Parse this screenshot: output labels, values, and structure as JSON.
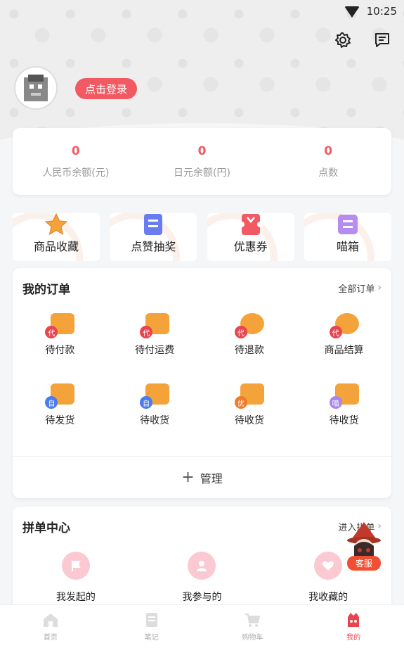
{
  "status_bar": {
    "time": "10:25"
  },
  "header": {
    "login_label": "点击登录"
  },
  "balance": [
    {
      "value": "0",
      "label": "人民币余额(元)"
    },
    {
      "value": "0",
      "label": "日元余额(円)"
    },
    {
      "value": "0",
      "label": "点数"
    }
  ],
  "shortcuts": [
    {
      "label": "商品收藏",
      "icon": "star-icon",
      "color": "#f3a33a"
    },
    {
      "label": "点赞抽奖",
      "icon": "list-icon",
      "color": "#6a7cf2"
    },
    {
      "label": "优惠券",
      "icon": "coupon-icon",
      "color": "#f25a63"
    },
    {
      "label": "喵箱",
      "icon": "box-icon",
      "color": "#b58cf0"
    }
  ],
  "orders": {
    "title": "我的订单",
    "all_label": "全部订单",
    "items": [
      {
        "label": "待付款",
        "badge": "代",
        "badge_color": "#e8454f",
        "icon_color": "#f3a33a",
        "icon": "wallet-icon"
      },
      {
        "label": "待付运费",
        "badge": "代",
        "badge_color": "#e8454f",
        "icon_color": "#f3a33a",
        "icon": "truck-yen-icon"
      },
      {
        "label": "待退款",
        "badge": "代",
        "badge_color": "#e8454f",
        "icon_color": "#f3a33a",
        "icon": "yen-coin-icon"
      },
      {
        "label": "商品结算",
        "badge": "代",
        "badge_color": "#e8454f",
        "icon_color": "#f3a33a",
        "icon": "check-icon"
      },
      {
        "label": "待发货",
        "badge": "自",
        "badge_color": "#4a7bf0",
        "icon_color": "#f3a33a",
        "icon": "truck-icon"
      },
      {
        "label": "待收货",
        "badge": "自",
        "badge_color": "#4a7bf0",
        "icon_color": "#f3a33a",
        "icon": "delivery-icon"
      },
      {
        "label": "待收货",
        "badge": "优",
        "badge_color": "#ef7b2a",
        "icon_color": "#f3a33a",
        "icon": "delivery-icon"
      },
      {
        "label": "待收货",
        "badge": "喵",
        "badge_color": "#a985ee",
        "icon_color": "#f3a33a",
        "icon": "delivery-icon"
      }
    ],
    "manage_label": "管理"
  },
  "group": {
    "title": "拼单中心",
    "enter_label": "进入拼单",
    "items": [
      {
        "label": "我发起的",
        "icon": "flag-icon"
      },
      {
        "label": "我参与的",
        "icon": "user-icon"
      },
      {
        "label": "我收藏的",
        "icon": "heart-icon"
      }
    ]
  },
  "service": {
    "label": "客服"
  },
  "tabbar": [
    {
      "label": "首页",
      "icon": "home-icon",
      "active": false
    },
    {
      "label": "笔记",
      "icon": "note-icon",
      "active": false
    },
    {
      "label": "购物车",
      "icon": "cart-icon",
      "active": false
    },
    {
      "label": "我的",
      "icon": "profile-icon",
      "active": true
    }
  ]
}
